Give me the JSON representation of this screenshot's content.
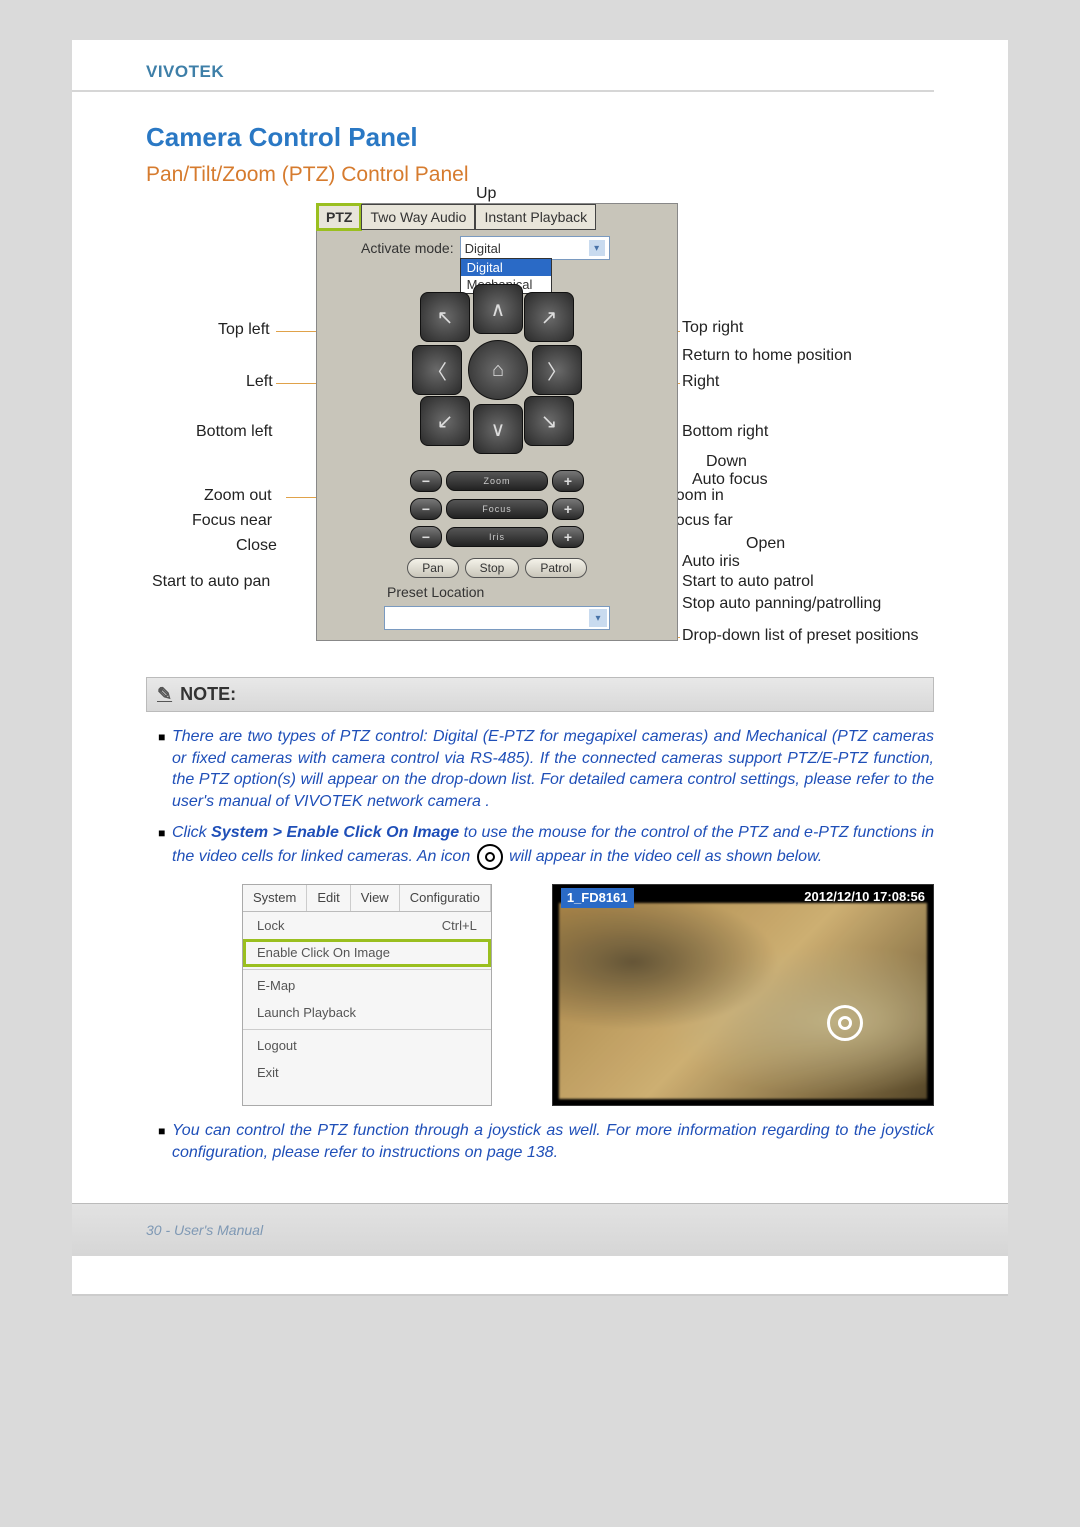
{
  "header": {
    "brand": "VIVOTEK"
  },
  "titles": {
    "h1": "Camera Control Panel",
    "h2": "Pan/Tilt/Zoom (PTZ) Control Panel"
  },
  "ptz": {
    "tabs": [
      "PTZ",
      "Two Way Audio",
      "Instant Playback"
    ],
    "mode_label": "Activate mode:",
    "mode_selected": "Digital",
    "mode_options": [
      "Digital",
      "Mechanical"
    ],
    "sliders": [
      "Zoom",
      "Focus",
      "Iris"
    ],
    "buttons": [
      "Pan",
      "Stop",
      "Patrol"
    ],
    "preset_label": "Preset Location"
  },
  "callouts": {
    "up": "Up",
    "top_left": "Top left",
    "left": "Left",
    "bottom_left": "Bottom left",
    "zoom_out": "Zoom out",
    "focus_near": "Focus near",
    "close": "Close",
    "auto_pan": "Start to auto pan",
    "top_right": "Top right",
    "return_home": "Return to home position",
    "right": "Right",
    "bottom_right": "Bottom right",
    "down": "Down",
    "auto_focus": "Auto focus",
    "zoom_in": "Zoom in",
    "focus_far": "Focus far",
    "open": "Open",
    "auto_iris": "Auto iris",
    "auto_patrol": "Start to auto patrol",
    "stop_auto": "Stop auto panning/patrolling",
    "preset_dd": "Drop-down list of preset positions"
  },
  "note": {
    "heading": "NOTE:",
    "item1": "There are two types of PTZ control: Digital (E-PTZ for megapixel cameras) and Mechanical (PTZ cameras or fixed cameras with camera control via RS-485). If the connected cameras support PTZ/E-PTZ function, the PTZ option(s) will appear on the drop-down list. For detailed camera control settings, please refer to the user's manual of VIVOTEK network camera .",
    "item2_a": "Click ",
    "item2_b": "System > Enable Click On Image",
    "item2_c": " to use the mouse for the control of the PTZ and e-PTZ functions in the video cells for linked cameras. An icon ",
    "item2_d": " will appear in the video cell as shown below.",
    "item3": "You can control the PTZ function through a joystick as well. For more information regarding to the joystick configuration, please refer to instructions on page 138."
  },
  "menu_shot": {
    "tabs": [
      "System",
      "Edit",
      "View",
      "Configuratio"
    ],
    "rows": [
      {
        "label": "Lock",
        "shortcut": "Ctrl+L"
      },
      {
        "label": "Enable Click On Image",
        "shortcut": "",
        "highlight": true
      },
      {
        "label": "E-Map",
        "shortcut": ""
      },
      {
        "label": "Launch Playback",
        "shortcut": ""
      },
      {
        "label": "Logout",
        "shortcut": ""
      },
      {
        "label": "Exit",
        "shortcut": ""
      }
    ]
  },
  "cam_shot": {
    "name": "1_FD8161",
    "timestamp": "2012/12/10  17:08:56"
  },
  "footer": {
    "text": "30 - User's Manual"
  }
}
